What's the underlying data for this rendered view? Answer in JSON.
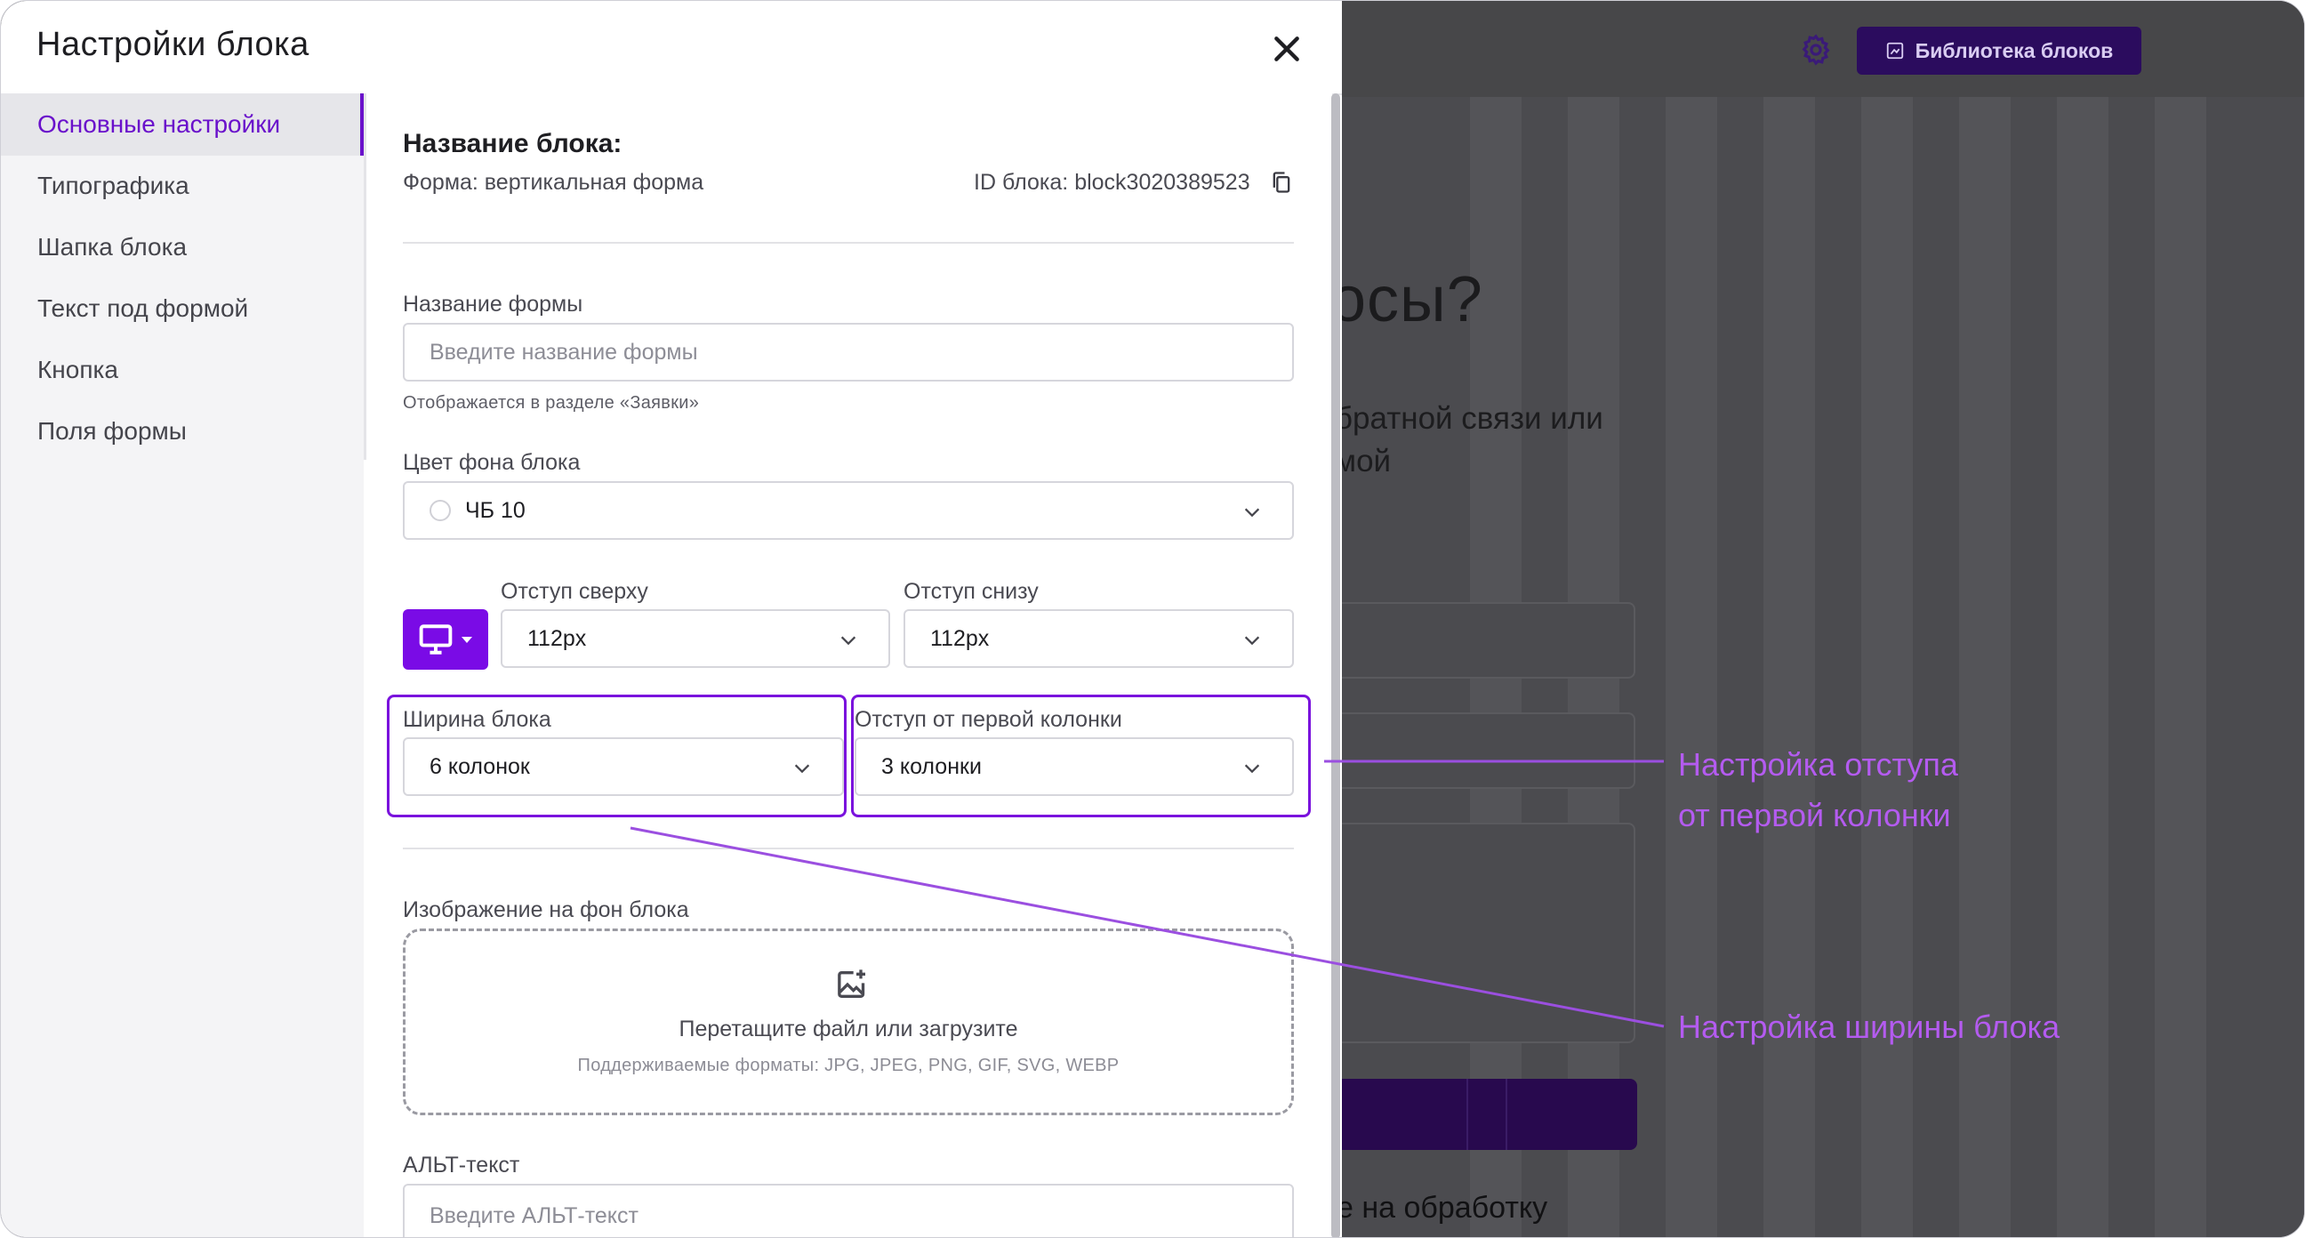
{
  "background": {
    "library_button_label": "Библиотека блоков",
    "heading_fragment": "осы?",
    "subtitle_line1": "братной связи или",
    "subtitle_line2": "мой",
    "footer_fragment": "е на обработку",
    "icons": [
      "settings-gear-icon",
      "library-icon"
    ]
  },
  "modal": {
    "title": "Настройки блока",
    "close_icon": "close-icon",
    "sidebar": {
      "items": [
        {
          "label": "Основные настройки",
          "active": true
        },
        {
          "label": "Типографика",
          "active": false
        },
        {
          "label": "Шапка блока",
          "active": false
        },
        {
          "label": "Текст под формой",
          "active": false
        },
        {
          "label": "Кнопка",
          "active": false
        },
        {
          "label": "Поля формы",
          "active": false
        }
      ]
    },
    "content": {
      "block_name_heading": "Название блока:",
      "form_type": "Форма: вертикальная форма",
      "block_id": "ID блока: block3020389523",
      "form_name": {
        "label": "Название формы",
        "placeholder": "Введите название формы",
        "hint": "Отображается в разделе «Заявки»"
      },
      "bg_color": {
        "label": "Цвет фона блока",
        "value": "ЧБ 10"
      },
      "padding_top": {
        "label": "Отступ сверху",
        "value": "112px"
      },
      "padding_bottom": {
        "label": "Отступ снизу",
        "value": "112px"
      },
      "block_width": {
        "label": "Ширина блока",
        "value": "6 колонок"
      },
      "first_column_offset": {
        "label": "Отступ от первой колонки",
        "value": "3 колонки"
      },
      "bg_image": {
        "label": "Изображение на фон блока",
        "drop_text": "Перетащите файл или загрузите",
        "formats": "Поддерживаемые форматы: JPG, JPEG, PNG, GIF, SVG, WEBP"
      },
      "alt_text": {
        "label": "АЛЬТ-текст",
        "placeholder": "Введите АЛЬТ-текст"
      }
    }
  },
  "annotations": {
    "offset_line1": "Настройка отступа",
    "offset_line2": "от первой колонки",
    "width": "Настройка ширины блока"
  },
  "colors": {
    "accent": "#7a0be6",
    "annotation": "#b45bf0",
    "overlay": "#4b4b4f",
    "library_button": "#2b0c5e"
  }
}
